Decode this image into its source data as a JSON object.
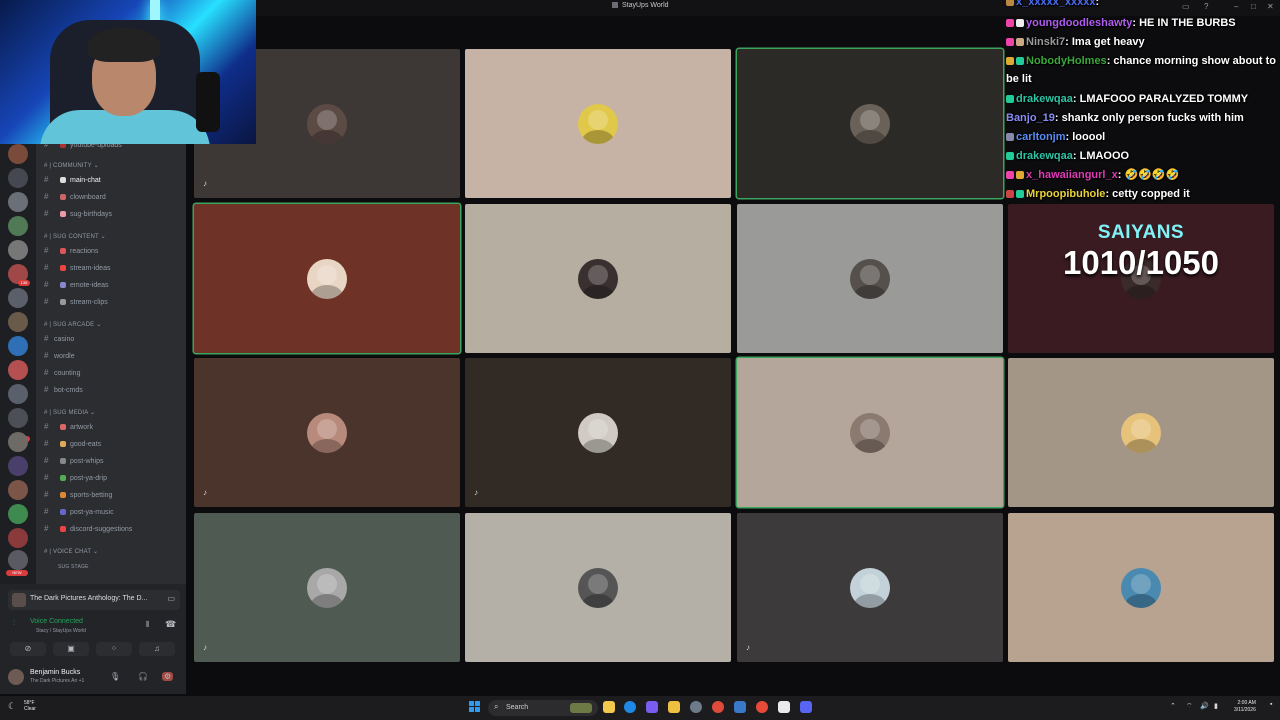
{
  "window": {
    "title": "StayUps World"
  },
  "webcam": {
    "label": "streamer webcam"
  },
  "rail": {
    "badges": [
      "136",
      "243",
      "NEW"
    ]
  },
  "sidebar": {
    "top_channel": "youtube-uploads",
    "categories": [
      {
        "name": "COMMUNITY",
        "channels": [
          "main-chat",
          "clownboard",
          "sug-birthdays"
        ]
      },
      {
        "name": "SUG CONTENT",
        "channels": [
          "reactions",
          "stream-ideas",
          "emote-ideas",
          "stream-clips"
        ]
      },
      {
        "name": "SUG ARCADE",
        "channels": [
          "casino",
          "wordle",
          "counting",
          "bot-cmds"
        ]
      },
      {
        "name": "SUG MEDIA",
        "channels": [
          "artwork",
          "good-eats",
          "post-whips",
          "post-ya-drip",
          "sports-betting",
          "post-ya-music",
          "discord-suggestions"
        ]
      },
      {
        "name": "VOICE CHAT",
        "channels": [
          "SUG STAGE"
        ]
      }
    ]
  },
  "voice_panel": {
    "activity": "The Dark Pictures Anthology: The D...",
    "status": "Voice Connected",
    "channel": "Stacy / StayUps World",
    "user_name": "Benjamin Bucks",
    "user_status": "The Dark Pictures An +1"
  },
  "chat": {
    "messages": [
      {
        "user": "x_xxxxx_xxxxx",
        "text": "",
        "color": "#4a6cf7"
      },
      {
        "user": "youngdoodleshawty",
        "text": "HE IN THE BURBS",
        "color": "#b05cf0"
      },
      {
        "user": "Ninski7",
        "text": "Ima get heavy",
        "color": "#9b9b9b"
      },
      {
        "user": "NobodyHolmes",
        "text": "chance morning show about to be lit",
        "color": "#3aa83a"
      },
      {
        "user": "drakewqaa",
        "text": "LMAFOOO PARALYZED TOMMY",
        "color": "#2ec4a6"
      },
      {
        "user": "Banjo_19",
        "text": "shankz only person fucks with him",
        "color": "#8a8cf5"
      },
      {
        "user": "carltonjm",
        "text": "looool",
        "color": "#5a8cf5"
      },
      {
        "user": "drakewqaa",
        "text": "LMAOOO",
        "color": "#2ec4a6"
      },
      {
        "user": "x_hawaiiangurl_x",
        "text": "🤣🤣🤣🤣",
        "color": "#e03ab8"
      },
      {
        "user": "Mrpoopibuhole",
        "text": "cetty copped it",
        "color": "#e8d23a"
      }
    ]
  },
  "saiyans": {
    "label": "SAIYANS",
    "count": "1010/1050"
  },
  "taskbar": {
    "weather_temp": "58°F",
    "weather_desc": "Clear",
    "search_placeholder": "Search",
    "time": "2:00 AM",
    "date": "3/11/2026"
  },
  "colors": {
    "speaking": "#3ba55d",
    "voice_connected": "#23a55a"
  }
}
